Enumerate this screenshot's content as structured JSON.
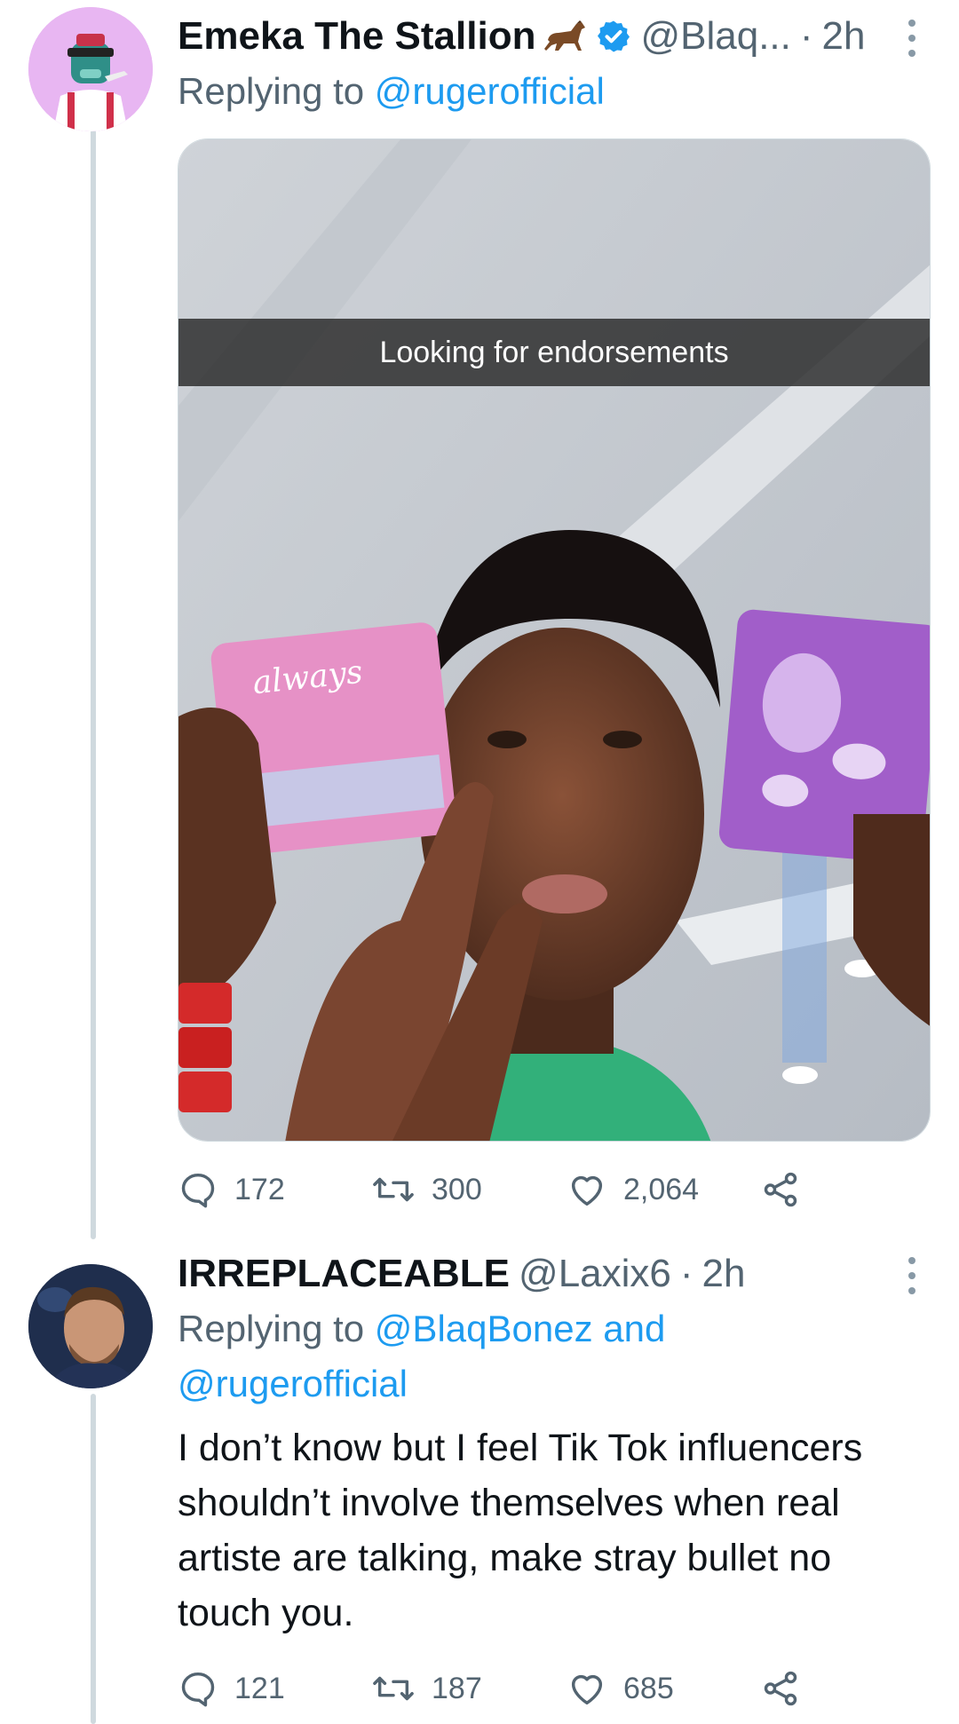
{
  "tweets": [
    {
      "display_name": "Emeka The Stallion",
      "name_emoji": "horse-icon",
      "verified": true,
      "handle": "@Blaq...",
      "separator": "·",
      "time": "2h",
      "reply_prefix": "Replying to",
      "reply_mentions": "@rugerofficial",
      "media_caption": "Looking for endorsements",
      "actions": {
        "replies": "172",
        "retweets": "300",
        "likes": "2,064"
      }
    },
    {
      "display_name": "IRREPLACEABLE",
      "handle": "@Laxix6",
      "separator": "·",
      "time": "2h",
      "reply_prefix": "Replying to",
      "reply_mentions_1": "@BlaqBonez and",
      "reply_mentions_2": "@rugerofficial",
      "text": "I don’t know but I feel Tik Tok influencers shouldn’t involve themselves when real artiste are talking, make stray bullet no touch you.",
      "actions": {
        "replies": "121",
        "retweets": "187",
        "likes": "685"
      }
    }
  ],
  "colors": {
    "text_primary": "#0f1419",
    "text_secondary": "#536471",
    "link": "#1d9bf0",
    "thread_line": "#cfd9de"
  }
}
